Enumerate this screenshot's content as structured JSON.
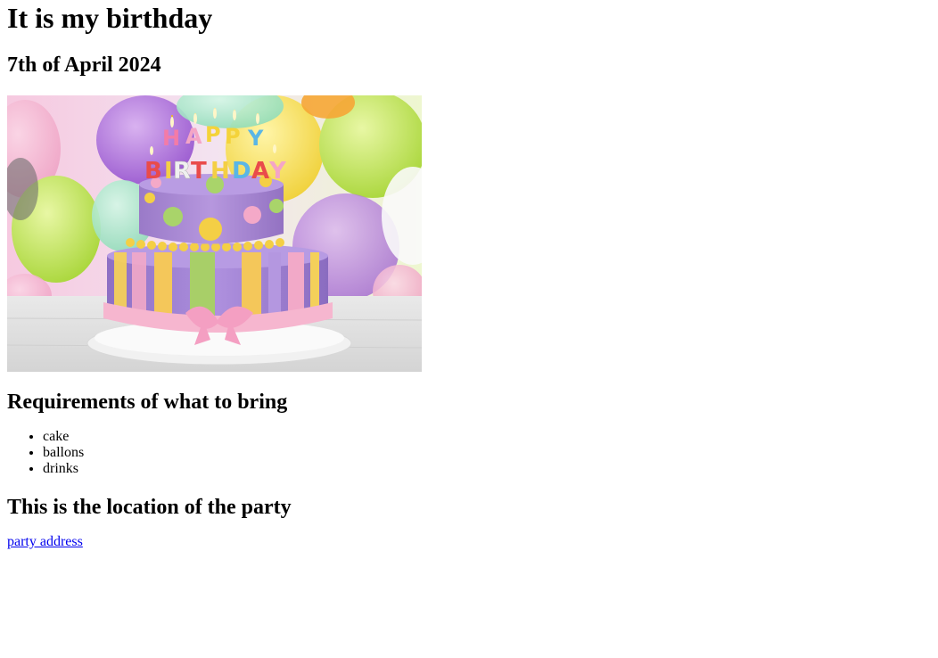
{
  "page": {
    "title": "It is my birthday",
    "date": "7th of April 2024",
    "image": {
      "banner_text_top": "HAPPY",
      "banner_text_bottom": "BIRTHDAY"
    },
    "requirements_heading": "Requirements of what to bring",
    "requirements": [
      "cake",
      "ballons",
      "drinks"
    ],
    "location_heading": "This is the location of the party",
    "location_link": "party address"
  },
  "colors": {
    "link": "#0000ee",
    "text": "#000000",
    "background": "#ffffff"
  }
}
